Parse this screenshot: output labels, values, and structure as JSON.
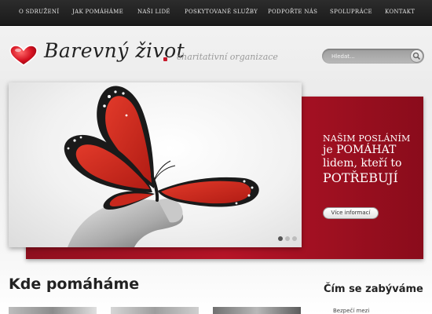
{
  "nav": {
    "items": [
      {
        "label": "O SDRUŽENÍ"
      },
      {
        "label": "JAK POMÁHÁME"
      },
      {
        "label": "NAŠI LIDÉ"
      },
      {
        "label": "POSKYTOVANÉ SLUŽBY"
      },
      {
        "label": "PODPOŘTE NÁS"
      },
      {
        "label": "SPOLUPRÁCE"
      },
      {
        "label": "KONTAKT"
      }
    ]
  },
  "logo": {
    "name": "Barevný život",
    "tagline": "charitativní organizace"
  },
  "search": {
    "placeholder": "Hledat..."
  },
  "slider": {
    "line1": "NAŠIM POSLÁNÍM",
    "line2": "je POMÁHAT",
    "line3": "lidem, kteří to",
    "line4": "POTŘEBUJÍ",
    "button_label": "Více informací",
    "current_slide": 1,
    "slide_count": 3
  },
  "sections": {
    "help_heading": "Kde pomáháme",
    "side_heading": "Čím se zabýváme",
    "side_link": "Bezpečí mezi"
  },
  "colors": {
    "accent_red": "#b51427",
    "nav_bg": "#1f1f1f"
  }
}
